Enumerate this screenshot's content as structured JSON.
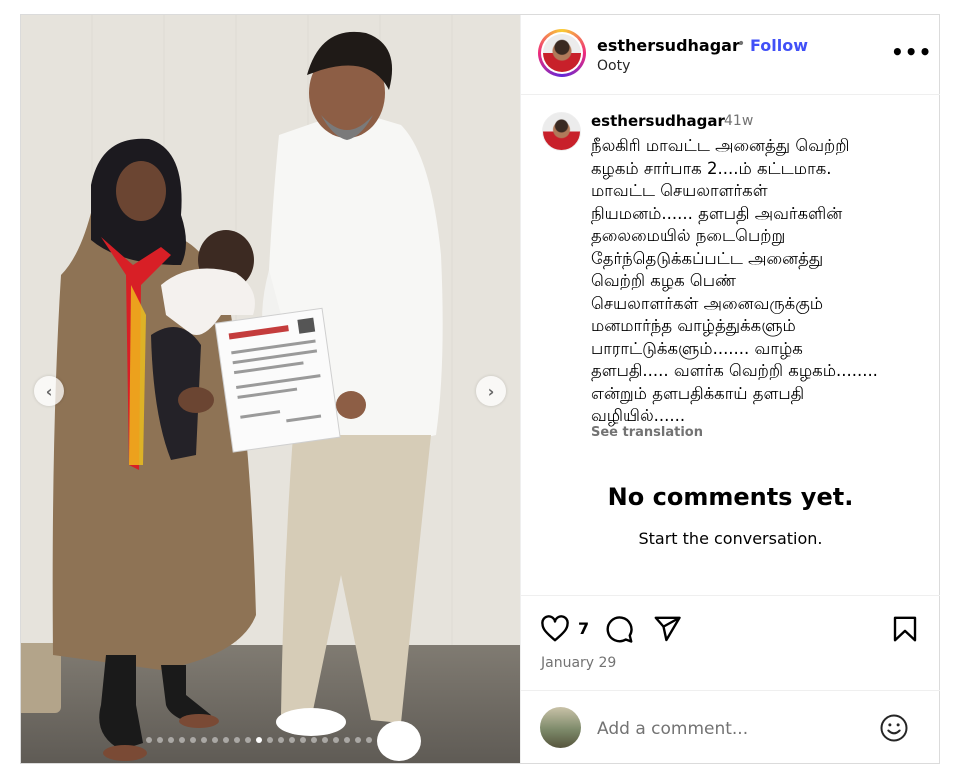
{
  "post": {
    "username": "esthersudhagar",
    "separator": "•",
    "follow_label": "Follow",
    "location": "Ooty",
    "more_label": "•••"
  },
  "caption": {
    "username": "esthersudhagar",
    "time": "41w",
    "text": "நீலகிரி மாவட்ட அனைத்து வெற்றி\nகழகம் சார்பாக 2....ம் கட்டமாக.\nமாவட்ட செயலாளர்கள்\nநியமனம்...... தளபதி அவர்களின்\nதலைமையில் நடைபெற்று\nதேர்ந்தெடுக்கப்பட்ட அனைத்து\nவெற்றி கழக பெண்\nசெயலாளர்கள் அனைவருக்கும்\nமனமார்ந்த வாழ்த்துக்களும்\nபாராட்டுக்களும்....... வாழ்க\nதளபதி..... வளர்க வெற்றி கழகம்........\nஎன்றும் தளபதிக்காய் தளபதி\nவழியில்......",
    "see_translation": "See translation"
  },
  "comments": {
    "empty_title": "No comments yet.",
    "empty_subtitle": "Start the conversation."
  },
  "actions": {
    "like_count": "7",
    "date": "January 29"
  },
  "add_comment": {
    "placeholder": "Add a comment..."
  },
  "carousel": {
    "total_slides": 22,
    "active_index": 10,
    "prev_glyph": "‹",
    "next_glyph": "›"
  },
  "icons": {
    "like": "heart-icon",
    "comment": "comment-icon",
    "share": "share-icon",
    "save": "bookmark-icon",
    "emoji": "emoji-icon",
    "more": "more-icon"
  },
  "colors": {
    "follow": "#4150f7",
    "muted": "#737373"
  }
}
